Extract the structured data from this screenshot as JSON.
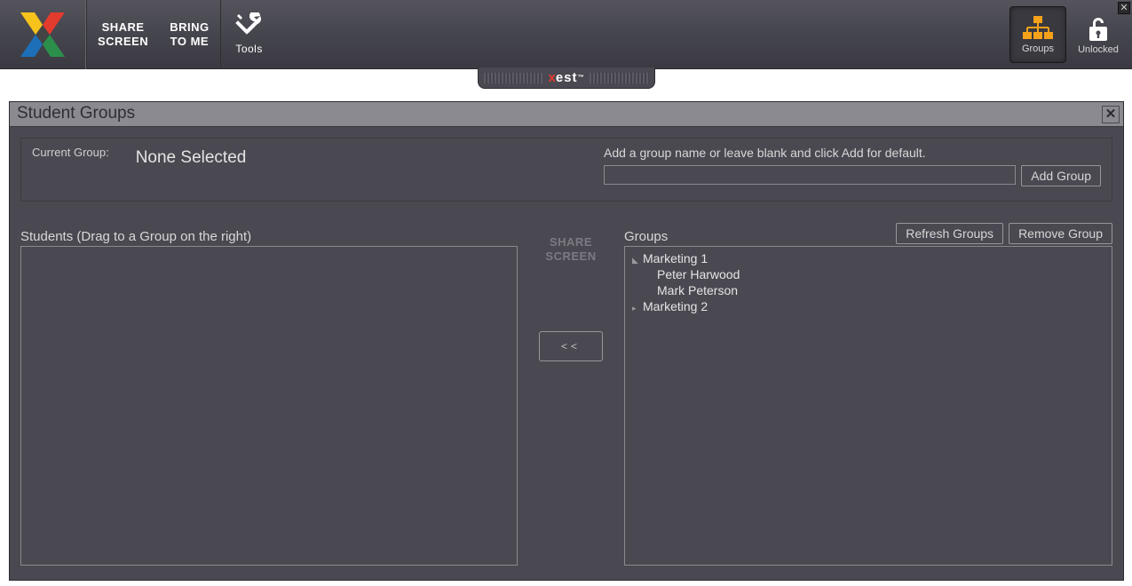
{
  "toolbar": {
    "share_screen": "SHARE\nSCREEN",
    "bring_to_me": "BRING\nTO ME",
    "tools_label": "Tools",
    "groups_label": "Groups",
    "unlocked_label": "Unlocked"
  },
  "brand": {
    "x": "x",
    "rest": "est"
  },
  "dialog": {
    "title": "Student Groups",
    "current_group_label": "Current Group:",
    "current_group_value": "None Selected",
    "add_hint": "Add a group name or leave blank and click Add for default.",
    "add_group_btn": "Add Group",
    "students_label": "Students (Drag to a Group on the right)",
    "groups_label": "Groups",
    "refresh_btn": "Refresh Groups",
    "remove_btn": "Remove Group",
    "share_disabled": "SHARE\nSCREEN",
    "move_btn": "<<",
    "group_name_value": ""
  },
  "groups_tree": [
    {
      "name": "Marketing 1",
      "expanded": true,
      "members": [
        "Peter Harwood",
        "Mark Peterson"
      ]
    },
    {
      "name": "Marketing 2",
      "expanded": false,
      "members": []
    }
  ],
  "students": []
}
